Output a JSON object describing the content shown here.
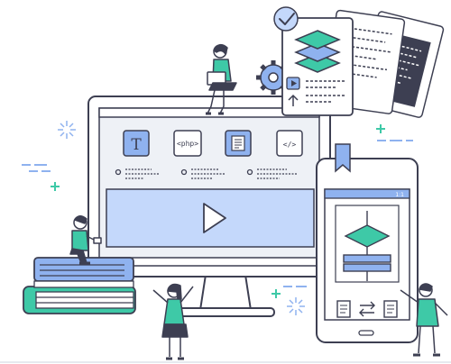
{
  "illustration": {
    "monitor": {
      "tiles": [
        {
          "icon": "text-icon",
          "label": "T"
        },
        {
          "icon": "php-icon",
          "label": "<php>"
        },
        {
          "icon": "document-icon",
          "label": ""
        },
        {
          "icon": "code-icon",
          "label": "</>"
        }
      ]
    },
    "phone": {
      "status_text": "1:1"
    }
  },
  "colors": {
    "outline": "#3d3f52",
    "teal": "#3ec9a7",
    "blue": "#8fb2ef",
    "light_blue": "#cfe0fb",
    "mint": "#dff6ef",
    "background": "#ffffff",
    "panel": "#eef1f6"
  }
}
